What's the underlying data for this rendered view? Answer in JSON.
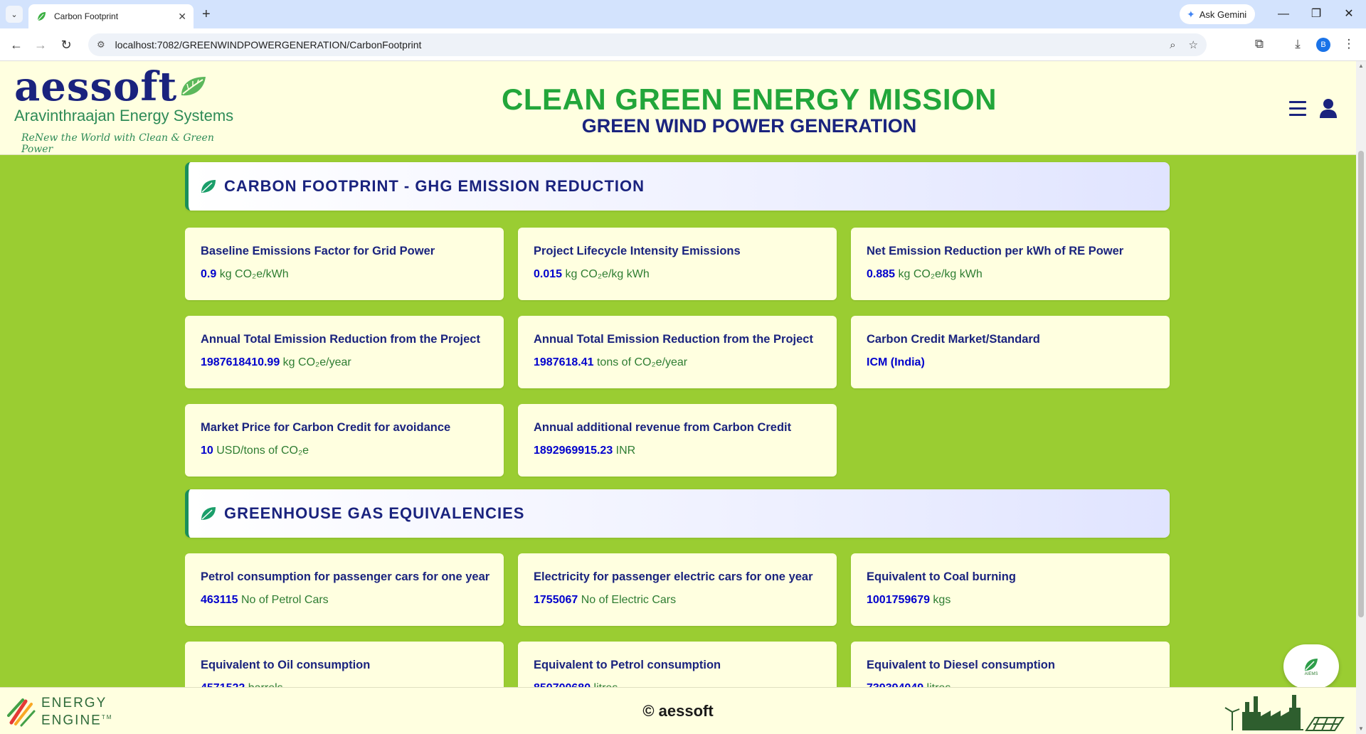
{
  "browser": {
    "tab_title": "Carbon Footprint",
    "url": "localhost:7082/GREENWINDPOWERGENERATION/CarbonFootprint",
    "gemini_label": "Ask Gemini",
    "profile_initial": "B"
  },
  "header": {
    "logo_word": "aessoft",
    "logo_subtitle": "Aravinthraajan Energy Systems",
    "logo_tagline": "ReNew the World with Clean & Green Power",
    "title": "CLEAN GREEN ENERGY MISSION",
    "subtitle": "GREEN WIND POWER GENERATION"
  },
  "sections": {
    "carbon": {
      "title": "CARBON FOOTPRINT - GHG EMISSION REDUCTION",
      "cards": [
        {
          "label": "Baseline Emissions Factor for Grid Power",
          "value": "0.9",
          "unit": " kg CO₂e/kWh"
        },
        {
          "label": "Project Lifecycle Intensity Emissions",
          "value": "0.015",
          "unit": " kg CO₂e/kg kWh"
        },
        {
          "label": "Net Emission Reduction per kWh of RE Power",
          "value": "0.885",
          "unit": " kg CO₂e/kg kWh"
        },
        {
          "label": "Annual Total Emission Reduction from the Project",
          "value": "1987618410.99",
          "unit": " kg CO₂e/year"
        },
        {
          "label": "Annual Total Emission Reduction from the Project",
          "value": "1987618.41",
          "unit": " tons of CO₂e/year"
        },
        {
          "label": "Carbon Credit Market/Standard",
          "value": "ICM (India)",
          "unit": ""
        },
        {
          "label": "Market Price for Carbon Credit for avoidance",
          "value": "10",
          "unit": " USD/tons of CO₂e"
        },
        {
          "label": "Annual additional revenue from Carbon Credit",
          "value": "1892969915.23",
          "unit": " INR"
        }
      ]
    },
    "ghg": {
      "title": "GREENHOUSE GAS EQUIVALENCIES",
      "cards": [
        {
          "label": "Petrol consumption for passenger cars for one year",
          "value": "463115",
          "unit": " No of Petrol Cars"
        },
        {
          "label": "Electricity for passenger electric cars for one year",
          "value": "1755067",
          "unit": " No of Electric Cars"
        },
        {
          "label": "Equivalent to Coal burning",
          "value": "1001759679",
          "unit": " kgs"
        },
        {
          "label": "Equivalent to Oil consumption",
          "value": "4571522",
          "unit": " barrels"
        },
        {
          "label": "Equivalent to Petrol consumption",
          "value": "850700680",
          "unit": " litres"
        },
        {
          "label": "Equivalent to Diesel consumption",
          "value": "739394049",
          "unit": " litres"
        }
      ]
    }
  },
  "footer": {
    "brand_line1": "ENERGY",
    "brand_line2": "ENGINE",
    "tm": "TM",
    "copyright": "© aessoft"
  },
  "fab": {
    "label": "AIEMS"
  },
  "colors": {
    "page_bg": "#9acd32",
    "card_bg": "#ffffe0",
    "navy": "#1a237e",
    "green": "#22a63a",
    "value_blue": "#0000cc"
  }
}
